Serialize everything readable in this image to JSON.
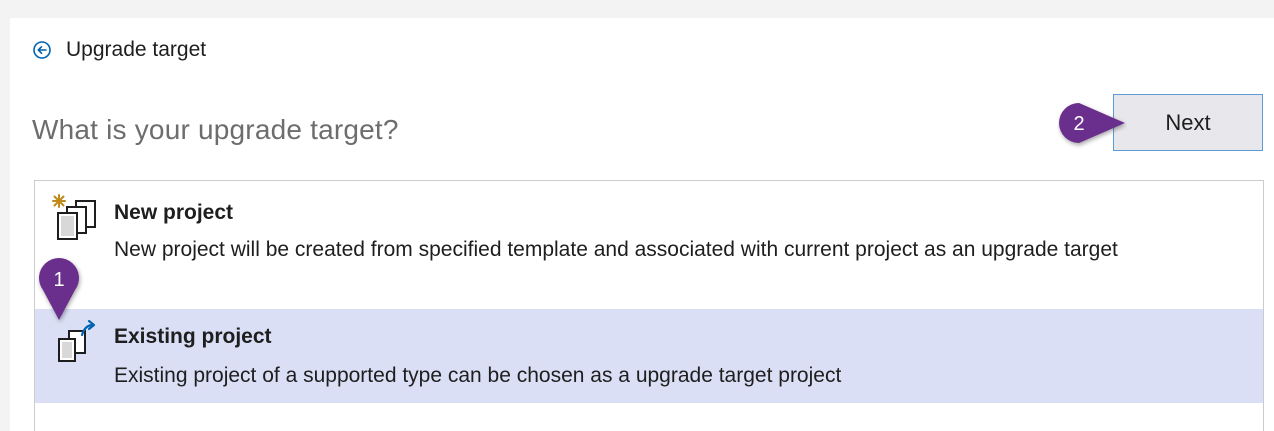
{
  "header": {
    "back_icon": "circle-arrow-left-icon",
    "title": "Upgrade target"
  },
  "question": "What is your upgrade target?",
  "next_button": {
    "label": "Next"
  },
  "callouts": [
    {
      "number": "1",
      "color": "#6b2d8c"
    },
    {
      "number": "2",
      "color": "#6b2d8c"
    }
  ],
  "options": [
    {
      "icon": "new-project-icon",
      "title": "New project",
      "description": "New project will be created from specified template and associated with current project as an upgrade target",
      "selected": false
    },
    {
      "icon": "existing-project-icon",
      "title": "Existing project",
      "description": "Existing project of a supported type can be chosen as a upgrade target project",
      "selected": true
    }
  ],
  "colors": {
    "accent": "#0063b1",
    "selection": "#dadff5",
    "button_border": "#5b9bd5",
    "callout": "#6b2d8c"
  }
}
